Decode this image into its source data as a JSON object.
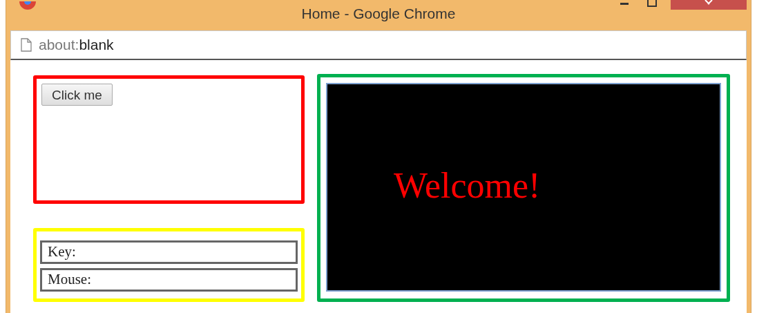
{
  "window": {
    "title": "Home - Google Chrome"
  },
  "address_bar": {
    "scheme": "about:",
    "path": "blank"
  },
  "page": {
    "button": "Click me",
    "fields": [
      {
        "label": "Key:"
      },
      {
        "label": "Mouse:"
      }
    ],
    "canvas": {
      "text": "Welcome!"
    }
  }
}
